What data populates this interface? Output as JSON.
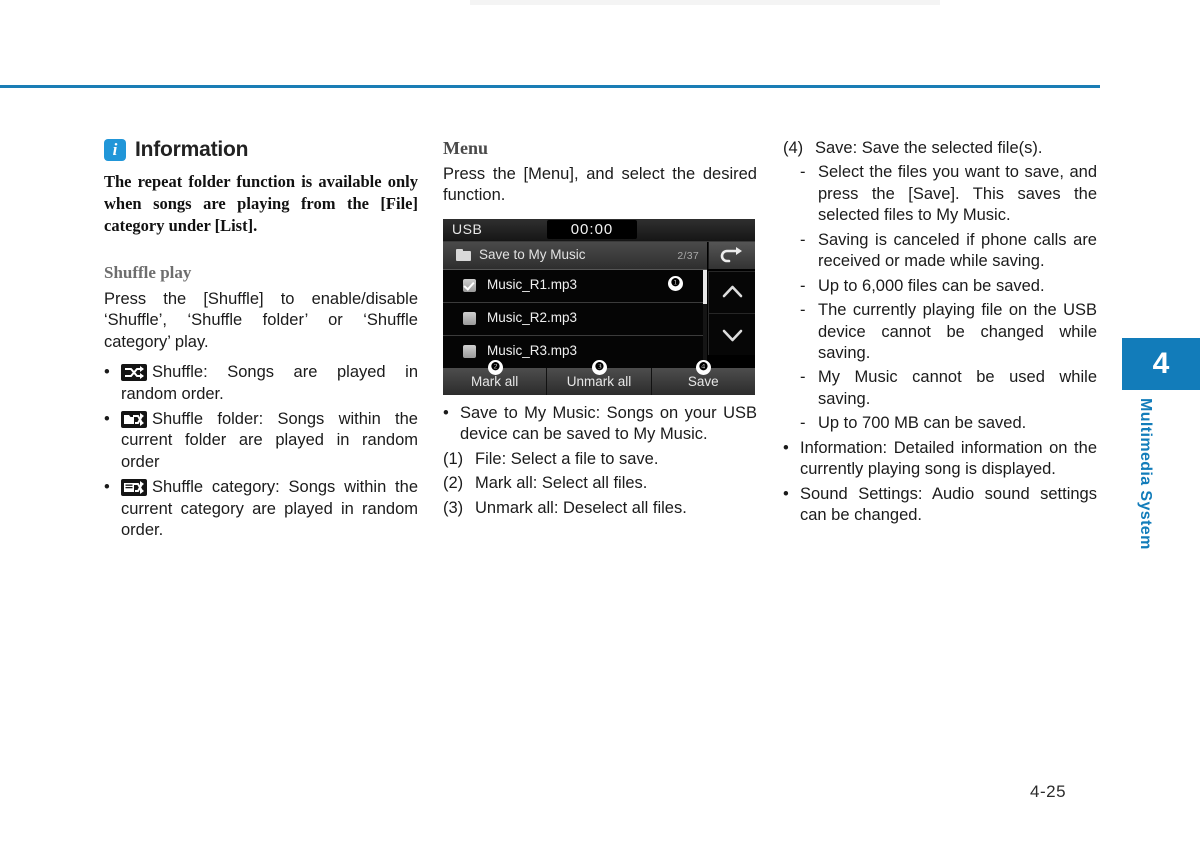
{
  "page": {
    "number": "4-25",
    "chapter_number": "4",
    "chapter_label": "Multimedia System",
    "accent_color": "#127cba",
    "rule_color": "#1a7db5"
  },
  "column_left": {
    "info_badge": "i",
    "info_heading": "Information",
    "info_body": "The repeat folder function is available only when songs are playing from the [File] category under [List].",
    "shuffle_heading": "Shuffle play",
    "shuffle_intro": "Press the [Shuffle] to enable/disable ‘Shuffle’, ‘Shuffle folder’ or ‘Shuffle category’ play.",
    "shuffle_items": [
      {
        "icon": "shuffle-icon",
        "text": "Shuffle: Songs are played in random order."
      },
      {
        "icon": "shuffle-folder-icon",
        "text": "Shuffle folder: Songs within the current folder are played in random order"
      },
      {
        "icon": "shuffle-category-icon",
        "text": "Shuffle category: Songs within the current category are played in random order."
      }
    ]
  },
  "column_middle": {
    "menu_heading": "Menu",
    "menu_intro": "Press the [Menu], and select the desired function.",
    "device": {
      "source": "USB",
      "clock": "00:00",
      "folder_icon": "folder-icon",
      "folder_title": "Save to My Music",
      "folder_count": "2/37",
      "back_icon": "back-arrow-icon",
      "scroll_up_icon": "chevron-up-icon",
      "scroll_down_icon": "chevron-down-icon",
      "rows": [
        {
          "label": "Music_R1.mp3",
          "checked": true,
          "callout": "❶"
        },
        {
          "label": "Music_R2.mp3",
          "checked": false,
          "callout": ""
        },
        {
          "label": "Music_R3.mp3",
          "checked": false,
          "callout": ""
        }
      ],
      "buttons": [
        {
          "label": "Mark all",
          "callout": "❷"
        },
        {
          "label": "Unmark all",
          "callout": "❸"
        },
        {
          "label": "Save",
          "callout": "❹"
        }
      ]
    },
    "bullets": [
      "Save to My Music: Songs on your USB device can be saved to My Music."
    ],
    "numbered": [
      {
        "marker": "(1)",
        "text": "File: Select a file to save."
      },
      {
        "marker": "(2)",
        "text": "Mark all: Select all files."
      },
      {
        "marker": "(3)",
        "text": "Unmark all: Deselect all files."
      }
    ]
  },
  "column_right": {
    "numbered_lead": {
      "marker": "(4)",
      "text": "Save: Save the selected file(s)."
    },
    "dashes": [
      "Select the files you want to save, and press the [Save]. This saves the selected files to My Music.",
      "Saving is canceled if phone calls are received or made while saving.",
      "Up to 6,000 files can be saved.",
      "The currently playing file on the USB device cannot be changed while saving.",
      "My Music cannot be used while saving.",
      "Up to 700 MB can be saved."
    ],
    "bullets": [
      "Information: Detailed information on the currently playing song is displayed.",
      "Sound Settings: Audio sound settings can be changed."
    ]
  }
}
